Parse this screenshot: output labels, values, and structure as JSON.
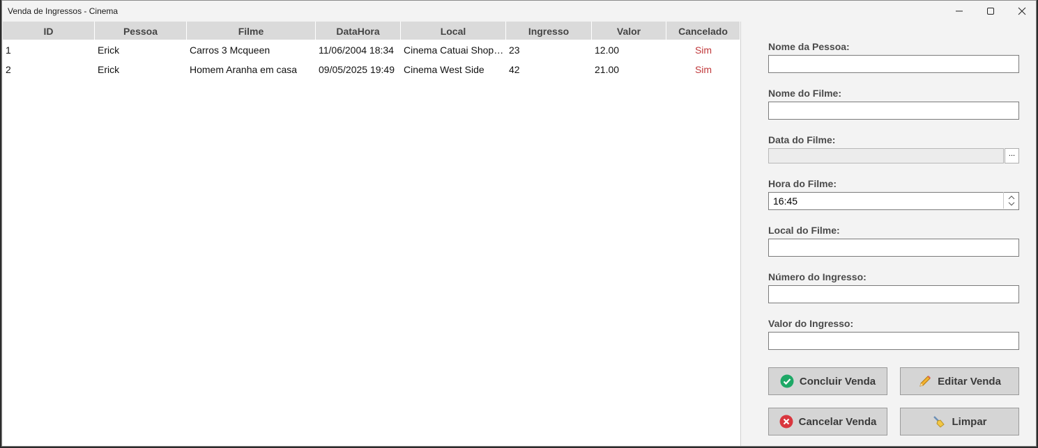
{
  "window": {
    "title": "Venda de Ingressos - Cinema"
  },
  "grid": {
    "columns": [
      "ID",
      "Pessoa",
      "Filme",
      "DataHora",
      "Local",
      "Ingresso",
      "Valor",
      "Cancelado"
    ],
    "rows": [
      {
        "id": "1",
        "pessoa": "Erick",
        "filme": "Carros 3 Mcqueen",
        "datahora": "11/06/2004 18:34",
        "local": "Cinema Catuai Shoppi...",
        "ingresso": "23",
        "valor": "12.00",
        "cancelado": "Sim"
      },
      {
        "id": "2",
        "pessoa": "Erick",
        "filme": "Homem Aranha em casa",
        "datahora": "09/05/2025 19:49",
        "local": "Cinema West Side",
        "ingresso": "42",
        "valor": "21.00",
        "cancelado": "Sim"
      }
    ]
  },
  "form": {
    "nome_pessoa_label": "Nome da Pessoa:",
    "nome_pessoa_value": "",
    "nome_filme_label": "Nome do Filme:",
    "nome_filme_value": "",
    "data_filme_label": "Data do Filme:",
    "data_filme_value": "",
    "data_picker_label": "...",
    "hora_filme_label": "Hora do Filme:",
    "hora_filme_value": "16:45",
    "local_filme_label": "Local do Filme:",
    "local_filme_value": "",
    "numero_ingresso_label": "Número do Ingresso:",
    "numero_ingresso_value": "",
    "valor_ingresso_label": "Valor do Ingresso:",
    "valor_ingresso_value": ""
  },
  "buttons": {
    "concluir": "Concluir Venda",
    "editar": "Editar Venda",
    "cancelar": "Cancelar Venda",
    "limpar": "Limpar"
  },
  "colors": {
    "cancelado_text": "#c0393b",
    "check_green": "#1ea866",
    "cancel_red": "#d9363e"
  },
  "icons": {
    "concluir": "check-circle-icon",
    "editar": "pencil-icon",
    "cancelar": "x-circle-icon",
    "limpar": "broom-icon"
  }
}
